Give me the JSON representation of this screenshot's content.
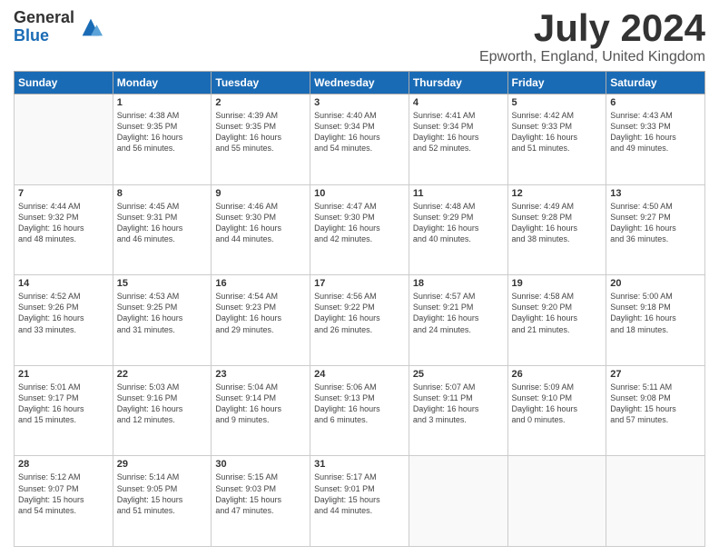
{
  "logo": {
    "general": "General",
    "blue": "Blue"
  },
  "title": "July 2024",
  "location": "Epworth, England, United Kingdom",
  "days_of_week": [
    "Sunday",
    "Monday",
    "Tuesday",
    "Wednesday",
    "Thursday",
    "Friday",
    "Saturday"
  ],
  "weeks": [
    [
      {
        "day": "",
        "info": ""
      },
      {
        "day": "1",
        "info": "Sunrise: 4:38 AM\nSunset: 9:35 PM\nDaylight: 16 hours\nand 56 minutes."
      },
      {
        "day": "2",
        "info": "Sunrise: 4:39 AM\nSunset: 9:35 PM\nDaylight: 16 hours\nand 55 minutes."
      },
      {
        "day": "3",
        "info": "Sunrise: 4:40 AM\nSunset: 9:34 PM\nDaylight: 16 hours\nand 54 minutes."
      },
      {
        "day": "4",
        "info": "Sunrise: 4:41 AM\nSunset: 9:34 PM\nDaylight: 16 hours\nand 52 minutes."
      },
      {
        "day": "5",
        "info": "Sunrise: 4:42 AM\nSunset: 9:33 PM\nDaylight: 16 hours\nand 51 minutes."
      },
      {
        "day": "6",
        "info": "Sunrise: 4:43 AM\nSunset: 9:33 PM\nDaylight: 16 hours\nand 49 minutes."
      }
    ],
    [
      {
        "day": "7",
        "info": "Sunrise: 4:44 AM\nSunset: 9:32 PM\nDaylight: 16 hours\nand 48 minutes."
      },
      {
        "day": "8",
        "info": "Sunrise: 4:45 AM\nSunset: 9:31 PM\nDaylight: 16 hours\nand 46 minutes."
      },
      {
        "day": "9",
        "info": "Sunrise: 4:46 AM\nSunset: 9:30 PM\nDaylight: 16 hours\nand 44 minutes."
      },
      {
        "day": "10",
        "info": "Sunrise: 4:47 AM\nSunset: 9:30 PM\nDaylight: 16 hours\nand 42 minutes."
      },
      {
        "day": "11",
        "info": "Sunrise: 4:48 AM\nSunset: 9:29 PM\nDaylight: 16 hours\nand 40 minutes."
      },
      {
        "day": "12",
        "info": "Sunrise: 4:49 AM\nSunset: 9:28 PM\nDaylight: 16 hours\nand 38 minutes."
      },
      {
        "day": "13",
        "info": "Sunrise: 4:50 AM\nSunset: 9:27 PM\nDaylight: 16 hours\nand 36 minutes."
      }
    ],
    [
      {
        "day": "14",
        "info": "Sunrise: 4:52 AM\nSunset: 9:26 PM\nDaylight: 16 hours\nand 33 minutes."
      },
      {
        "day": "15",
        "info": "Sunrise: 4:53 AM\nSunset: 9:25 PM\nDaylight: 16 hours\nand 31 minutes."
      },
      {
        "day": "16",
        "info": "Sunrise: 4:54 AM\nSunset: 9:23 PM\nDaylight: 16 hours\nand 29 minutes."
      },
      {
        "day": "17",
        "info": "Sunrise: 4:56 AM\nSunset: 9:22 PM\nDaylight: 16 hours\nand 26 minutes."
      },
      {
        "day": "18",
        "info": "Sunrise: 4:57 AM\nSunset: 9:21 PM\nDaylight: 16 hours\nand 24 minutes."
      },
      {
        "day": "19",
        "info": "Sunrise: 4:58 AM\nSunset: 9:20 PM\nDaylight: 16 hours\nand 21 minutes."
      },
      {
        "day": "20",
        "info": "Sunrise: 5:00 AM\nSunset: 9:18 PM\nDaylight: 16 hours\nand 18 minutes."
      }
    ],
    [
      {
        "day": "21",
        "info": "Sunrise: 5:01 AM\nSunset: 9:17 PM\nDaylight: 16 hours\nand 15 minutes."
      },
      {
        "day": "22",
        "info": "Sunrise: 5:03 AM\nSunset: 9:16 PM\nDaylight: 16 hours\nand 12 minutes."
      },
      {
        "day": "23",
        "info": "Sunrise: 5:04 AM\nSunset: 9:14 PM\nDaylight: 16 hours\nand 9 minutes."
      },
      {
        "day": "24",
        "info": "Sunrise: 5:06 AM\nSunset: 9:13 PM\nDaylight: 16 hours\nand 6 minutes."
      },
      {
        "day": "25",
        "info": "Sunrise: 5:07 AM\nSunset: 9:11 PM\nDaylight: 16 hours\nand 3 minutes."
      },
      {
        "day": "26",
        "info": "Sunrise: 5:09 AM\nSunset: 9:10 PM\nDaylight: 16 hours\nand 0 minutes."
      },
      {
        "day": "27",
        "info": "Sunrise: 5:11 AM\nSunset: 9:08 PM\nDaylight: 15 hours\nand 57 minutes."
      }
    ],
    [
      {
        "day": "28",
        "info": "Sunrise: 5:12 AM\nSunset: 9:07 PM\nDaylight: 15 hours\nand 54 minutes."
      },
      {
        "day": "29",
        "info": "Sunrise: 5:14 AM\nSunset: 9:05 PM\nDaylight: 15 hours\nand 51 minutes."
      },
      {
        "day": "30",
        "info": "Sunrise: 5:15 AM\nSunset: 9:03 PM\nDaylight: 15 hours\nand 47 minutes."
      },
      {
        "day": "31",
        "info": "Sunrise: 5:17 AM\nSunset: 9:01 PM\nDaylight: 15 hours\nand 44 minutes."
      },
      {
        "day": "",
        "info": ""
      },
      {
        "day": "",
        "info": ""
      },
      {
        "day": "",
        "info": ""
      }
    ]
  ]
}
